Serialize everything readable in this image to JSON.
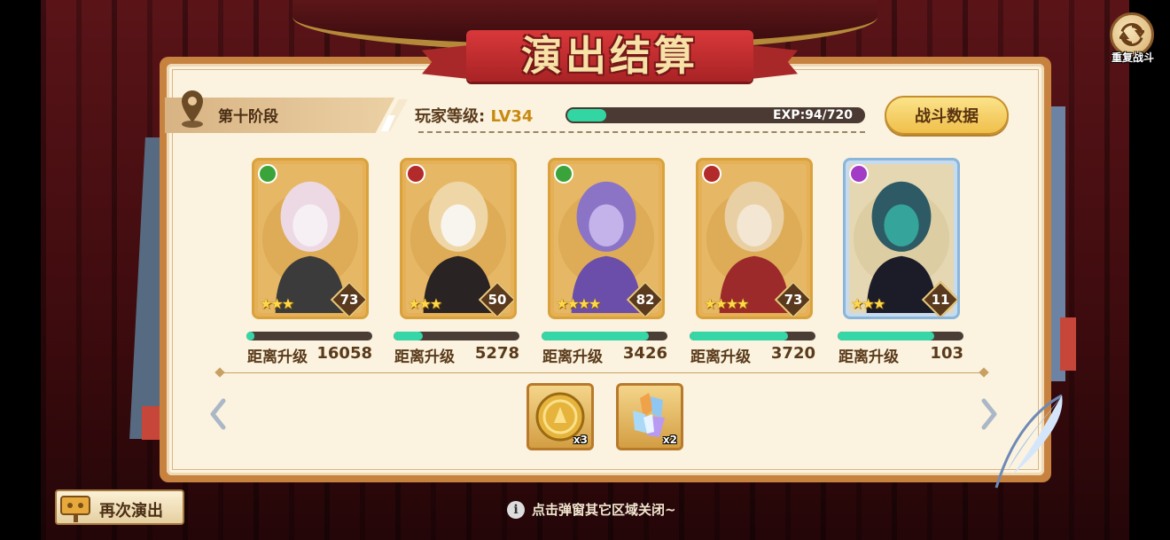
{
  "title": "演出结算",
  "replay": {
    "label": "重复战斗",
    "icon": "refresh-icon"
  },
  "stage": {
    "label": "第十阶段",
    "icon": "map-pin-icon"
  },
  "player": {
    "label": "玩家等级:",
    "level": "LV34",
    "exp_text": "EXP:94/720",
    "exp_fraction": 0.13
  },
  "battle_stats_button": "战斗数据",
  "heroes": [
    {
      "class_color": "green",
      "stars": "★★★",
      "level": "73",
      "progress": 0.06,
      "up_label": "距离升级",
      "up_value": "16058"
    },
    {
      "class_color": "red",
      "stars": "★★★",
      "level": "50",
      "progress": 0.23,
      "up_label": "距离升级",
      "up_value": "5278"
    },
    {
      "class_color": "green",
      "stars": "★★★★",
      "level": "82",
      "progress": 0.85,
      "up_label": "距离升级",
      "up_value": "3426"
    },
    {
      "class_color": "red",
      "stars": "★★★★",
      "level": "73",
      "progress": 0.78,
      "up_label": "距离升级",
      "up_value": "3720"
    },
    {
      "class_color": "purple",
      "stars": "★★★",
      "level": "11",
      "progress": 0.77,
      "up_label": "距离升级",
      "up_value": "103"
    }
  ],
  "rewards": [
    {
      "icon": "gold-coin-icon",
      "count": "x3"
    },
    {
      "icon": "crystal-icon",
      "count": "x2"
    }
  ],
  "again_button": "再次演出",
  "hint": "点击弹窗其它区域关闭~",
  "colors": {
    "panel_bg": "#fbf3df",
    "panel_border": "#c8823f",
    "title_ribbon": "#c32e30",
    "progress_fill": "#36d6a6",
    "button_gold": "#f0bf4a"
  }
}
